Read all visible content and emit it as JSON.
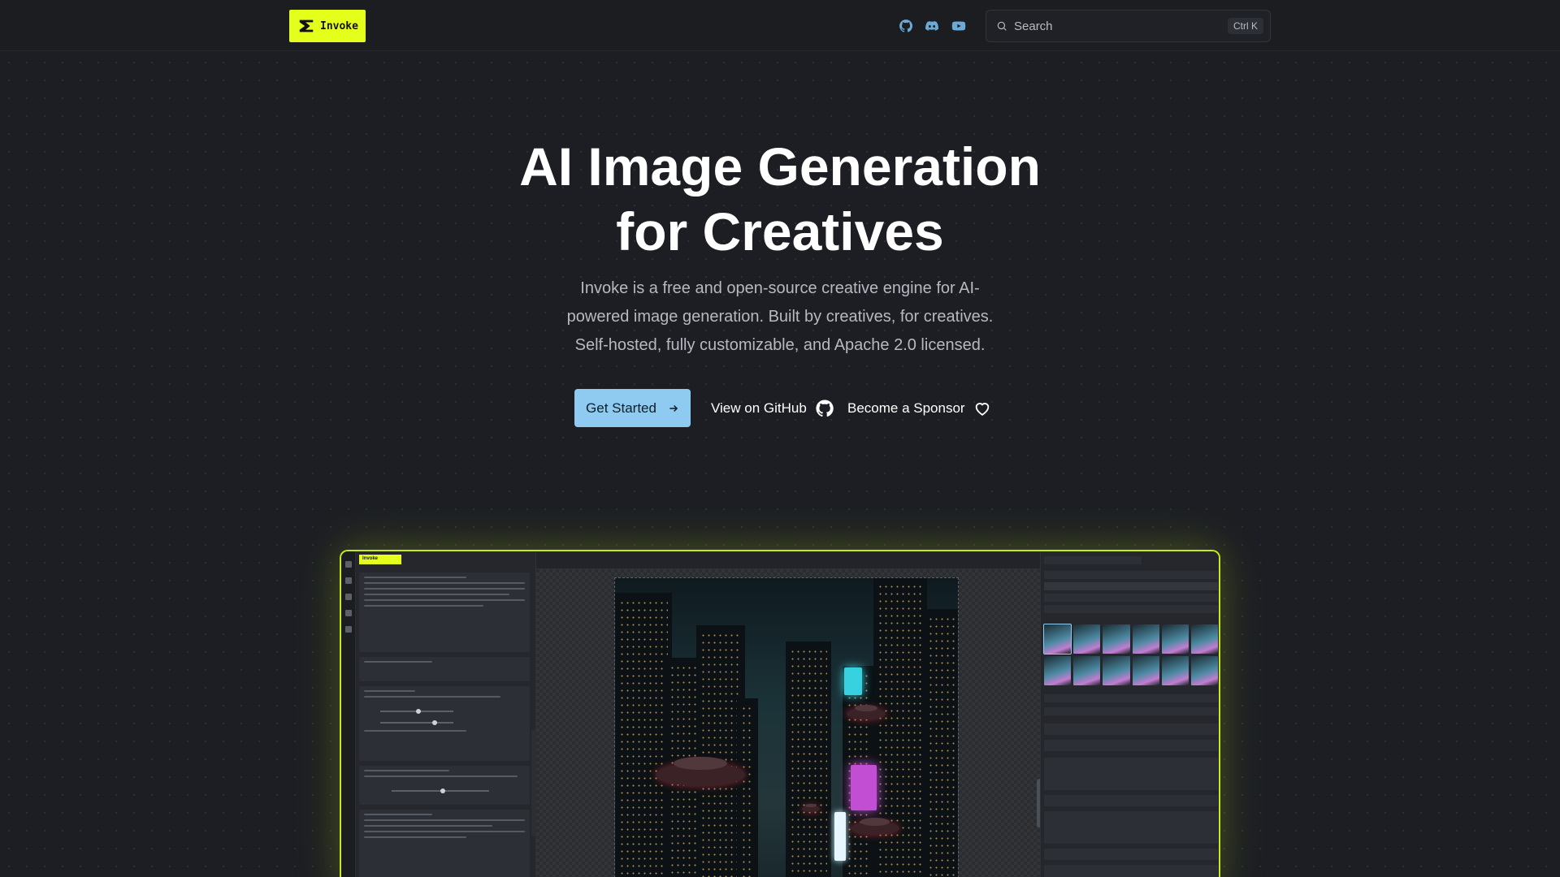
{
  "header": {
    "logo_text": "Invoke",
    "search": {
      "placeholder": "Search",
      "shortcut": "Ctrl K"
    },
    "social": [
      {
        "icon": "github-icon"
      },
      {
        "icon": "discord-icon"
      },
      {
        "icon": "youtube-icon"
      }
    ]
  },
  "hero": {
    "title_line1": "AI Image Generation",
    "title_line2": "for Creatives",
    "subtitle_line1": "Invoke is a free and open-source creative engine for AI-",
    "subtitle_line2": "powered image generation. Built by creatives, for creatives.",
    "subtitle_line3": "Self-hosted, fully customizable, and Apache 2.0 licensed.",
    "primary_cta": "Get Started",
    "github_cta": "View on GitHub",
    "sponsor_cta": "Become a Sponsor"
  },
  "colors": {
    "background": "#1c1e23",
    "brand_yellow": "#e5ff1c",
    "primary_button": "#8fcbf0",
    "social_icon": "#6ba9d6"
  },
  "screenshot": {
    "app_tab_label": "Invoke"
  }
}
